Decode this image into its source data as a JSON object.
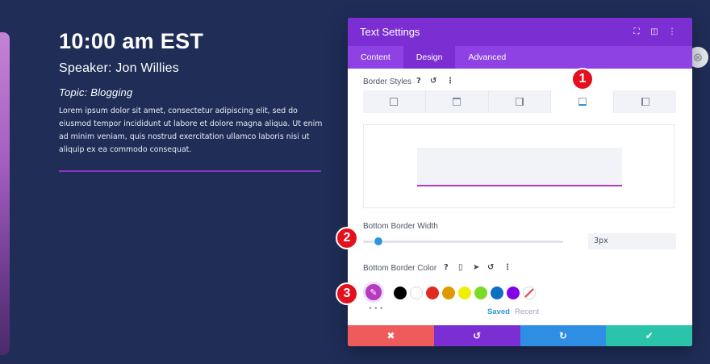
{
  "event": {
    "time": "10:00 am EST",
    "speaker": "Speaker: Jon Willies",
    "topic": "Topic: Blogging",
    "description": "Lorem ipsum dolor sit amet, consectetur adipiscing elit, sed do eiusmod tempor incididunt ut labore et dolore magna aliqua. Ut enim ad minim veniam, quis nostrud exercitation ullamco laboris nisi ut aliquip ex ea commodo consequat."
  },
  "modal": {
    "title": "Text Settings",
    "header_icons": [
      "expand-icon",
      "split-view-icon",
      "more-options-icon"
    ],
    "tabs": [
      {
        "label": "Content",
        "active": false
      },
      {
        "label": "Design",
        "active": true
      },
      {
        "label": "Advanced",
        "active": false
      }
    ],
    "border_styles": {
      "label": "Border Styles",
      "options": [
        "all",
        "top",
        "right",
        "bottom",
        "left"
      ],
      "active": "bottom"
    },
    "bottom_border_width": {
      "label": "Bottom Border Width",
      "value": "3px",
      "slider_fraction": 0.06
    },
    "bottom_border_color": {
      "label": "Bottom Border Color",
      "selected_color": "#b53bc2",
      "swatches": [
        "#000000",
        "#ffffff",
        "#e02b20",
        "#e09900",
        "#edf000",
        "#7cda24",
        "#0c71c3",
        "#8300e9",
        "none"
      ],
      "tabs": {
        "saved": "Saved",
        "recent": "Recent"
      }
    },
    "footer": {
      "cancel_icon": "✖",
      "undo_icon": "↺",
      "redo_icon": "↻",
      "save_icon": "✔"
    }
  },
  "badges": [
    "1",
    "2",
    "3"
  ],
  "colors": {
    "page_bg": "#1f2d57",
    "accent_purple": "#7b2fd3",
    "border_preview": "#b23cc4",
    "badge_red": "#e5101e"
  }
}
